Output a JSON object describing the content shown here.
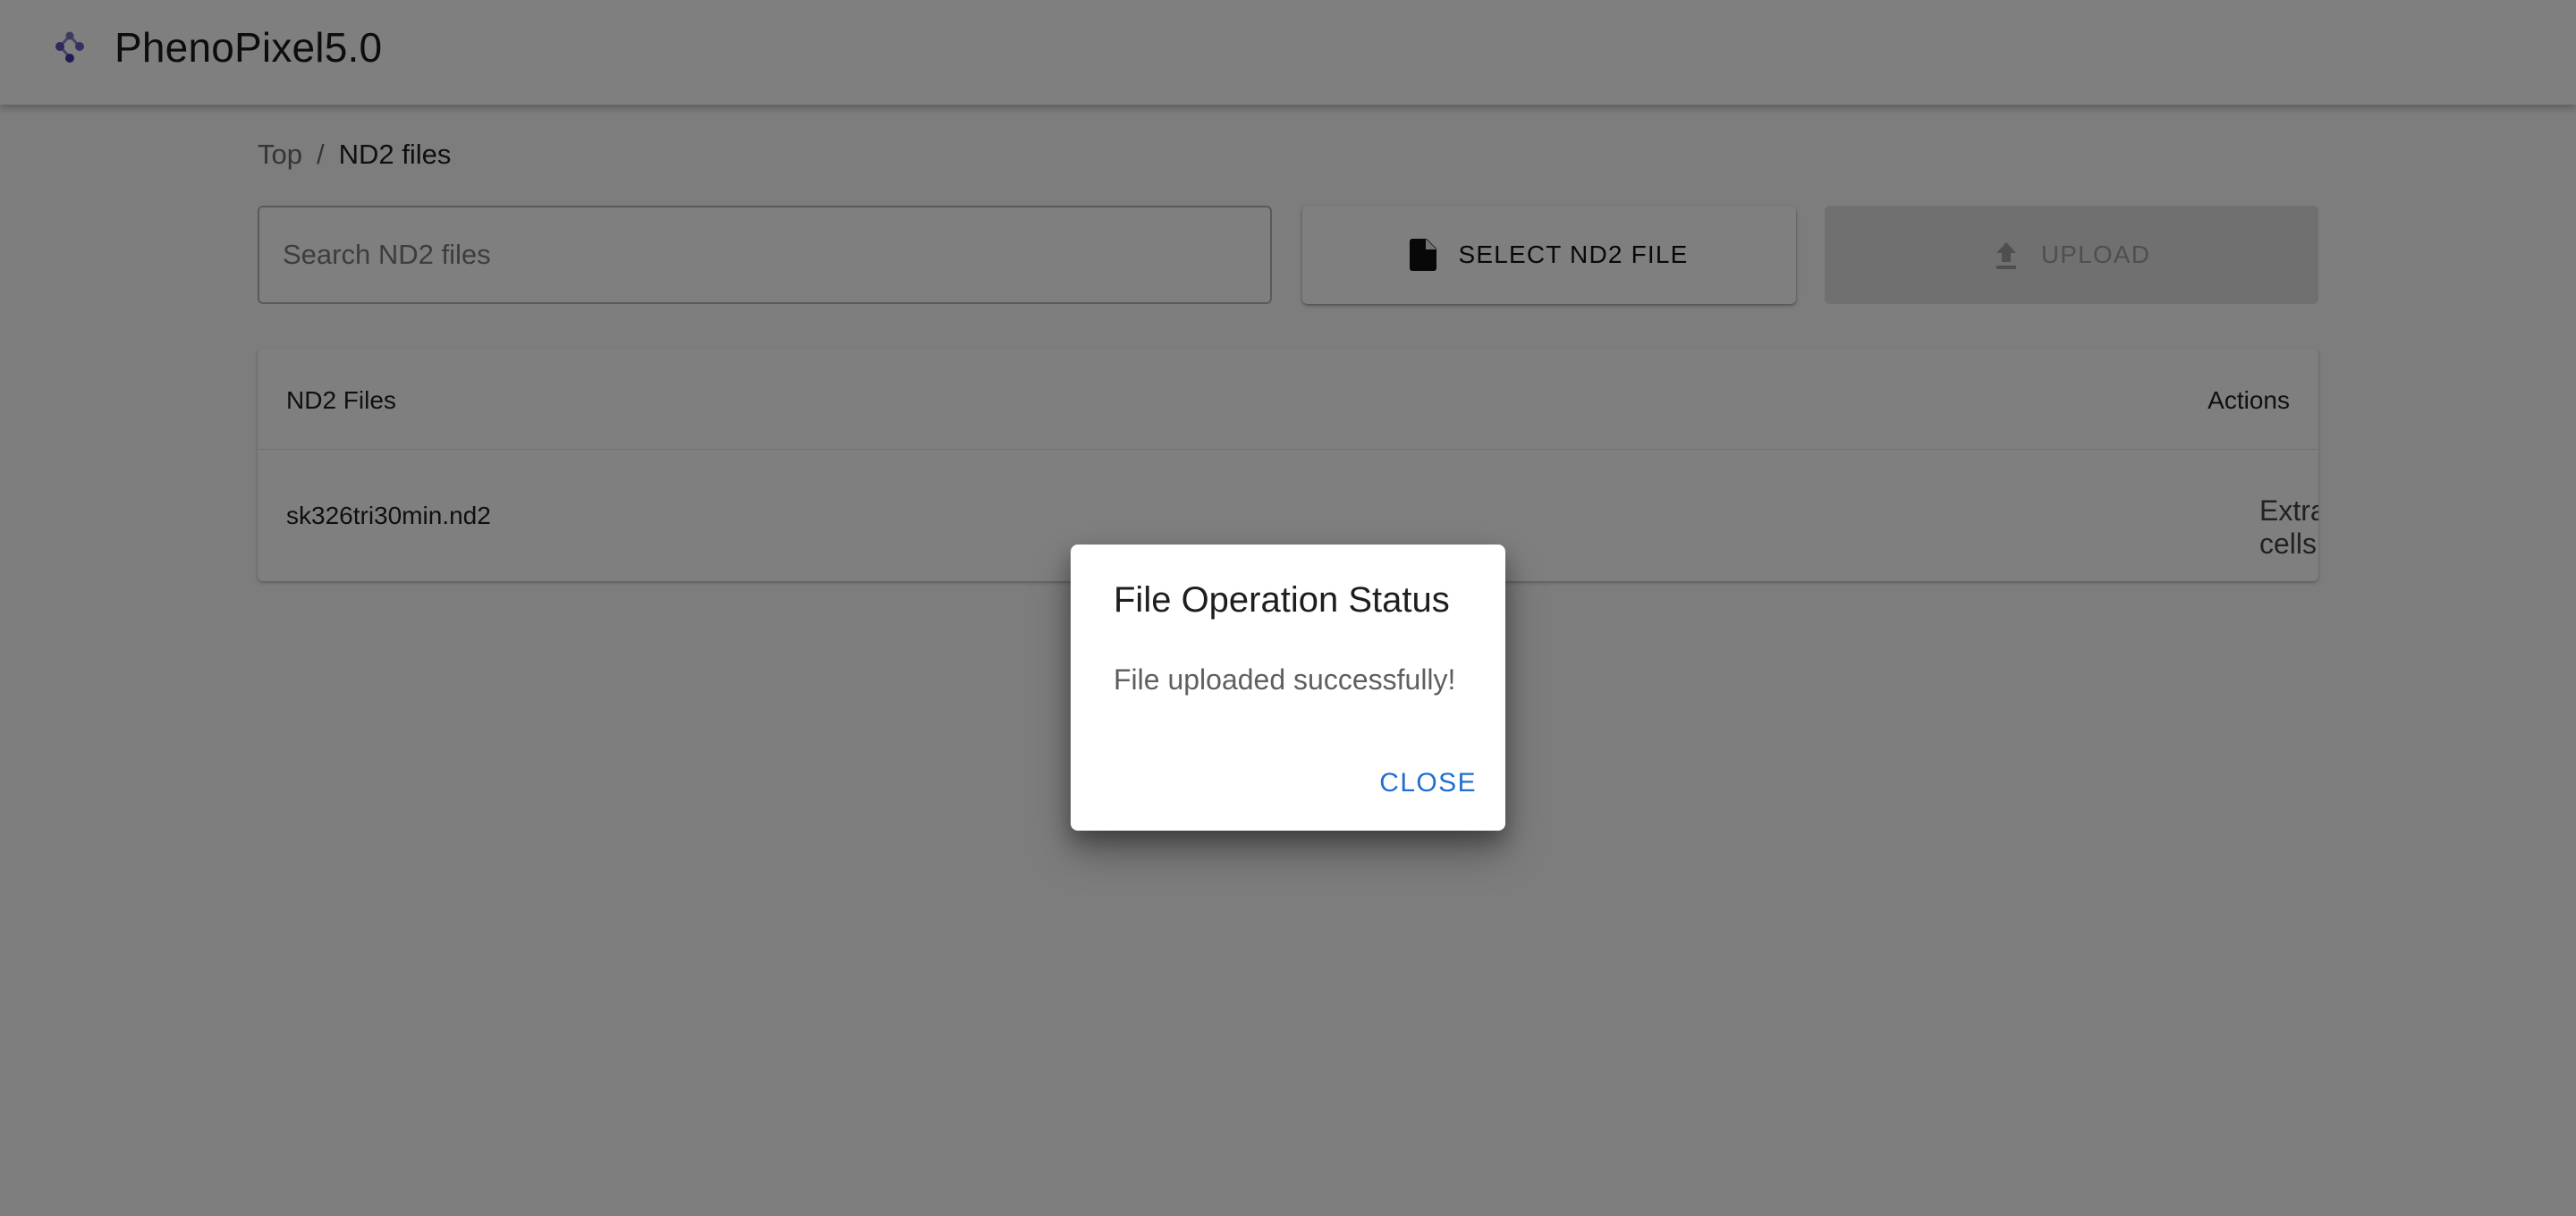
{
  "app": {
    "title": "PhenoPixel5.0",
    "logo_icon": "molecule-icon",
    "accent_color": "#3f51b5"
  },
  "breadcrumb": {
    "items": [
      {
        "label": "Top",
        "link": true
      },
      {
        "label": "ND2 files",
        "link": false
      }
    ],
    "separator": "/"
  },
  "search": {
    "placeholder": "Search ND2 files",
    "value": ""
  },
  "toolbar": {
    "select_label": "SELECT ND2 FILE",
    "select_icon": "file-icon",
    "upload_label": "UPLOAD",
    "upload_icon": "upload-icon",
    "upload_disabled": true
  },
  "table": {
    "columns": [
      "ND2 Files",
      "Actions"
    ],
    "rows": [
      {
        "file": "sk326tri30min.nd2",
        "extract_label": "Extract cells",
        "delete_icon": "trash-icon",
        "delete_color": "#c62828"
      }
    ]
  },
  "dialog": {
    "title": "File Operation Status",
    "message": "File uploaded successfully!",
    "close_label": "CLOSE",
    "close_color": "#1f6fd1"
  }
}
